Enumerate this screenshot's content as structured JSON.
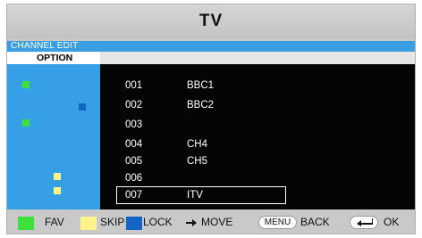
{
  "title": "TV",
  "section": "CHANNEL EDIT",
  "option_label": "OPTION",
  "colors": {
    "fav": "#3ee03a",
    "skip": "#fff38a",
    "lock": "#1565c8",
    "panel_blue": "#35a0e6",
    "list_bg": "#050505"
  },
  "channels": [
    {
      "number": "001",
      "name": "BBC1",
      "fav": true,
      "skip": false,
      "lock": false
    },
    {
      "number": "002",
      "name": "BBC2",
      "fav": false,
      "skip": false,
      "lock": true
    },
    {
      "number": "003",
      "name": "",
      "fav": true,
      "skip": false,
      "lock": false
    },
    {
      "number": "004",
      "name": "CH4",
      "fav": false,
      "skip": false,
      "lock": false
    },
    {
      "number": "005",
      "name": "CH5",
      "fav": false,
      "skip": false,
      "lock": false
    },
    {
      "number": "006",
      "name": "",
      "fav": false,
      "skip": true,
      "lock": false
    },
    {
      "number": "007",
      "name": "ITV",
      "fav": false,
      "skip": true,
      "lock": false,
      "selected": true
    }
  ],
  "footer": {
    "fav": "FAV",
    "skip": "SKIP",
    "lock": "LOCK",
    "move": "MOVE",
    "menu_key": "MENU",
    "back": "BACK",
    "ok": "OK"
  }
}
